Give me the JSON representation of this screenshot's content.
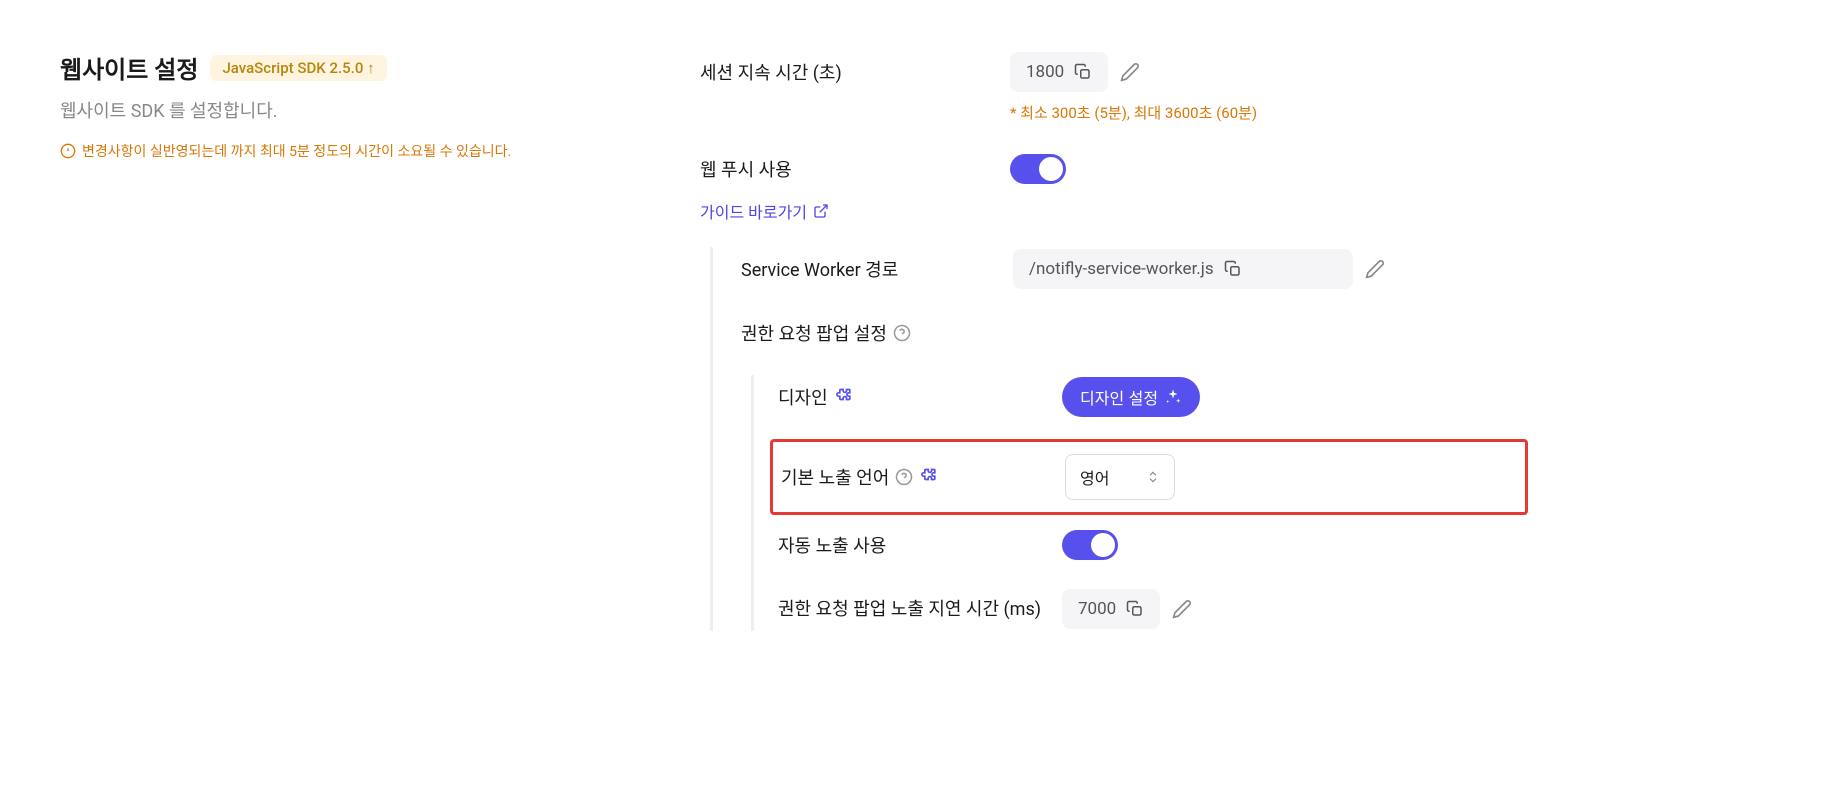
{
  "header": {
    "title": "웹사이트 설정",
    "sdk_badge": "JavaScript SDK 2.5.0 ↑",
    "subtitle": "웹사이트 SDK 를 설정합니다.",
    "warning": "변경사항이 실반영되는데 까지 최대 5분 정도의 시간이 소요될 수 있습니다."
  },
  "settings": {
    "session_duration": {
      "label": "세션 지속 시간 (초)",
      "value": "1800",
      "hint": "* 최소 300초 (5분), 최대 3600초 (60분)"
    },
    "web_push": {
      "label": "웹 푸시 사용",
      "guide_link": "가이드 바로가기"
    },
    "service_worker": {
      "label": "Service Worker 경로",
      "value": "/notifly-service-worker.js"
    },
    "permission_popup": {
      "label": "권한 요청 팝업 설정"
    },
    "design": {
      "label": "디자인",
      "button": "디자인 설정"
    },
    "default_language": {
      "label": "기본 노출 언어",
      "value": "영어"
    },
    "auto_show": {
      "label": "자동 노출 사용"
    },
    "popup_delay": {
      "label": "권한 요청 팝업 노출 지연 시간 (ms)",
      "value": "7000"
    }
  }
}
